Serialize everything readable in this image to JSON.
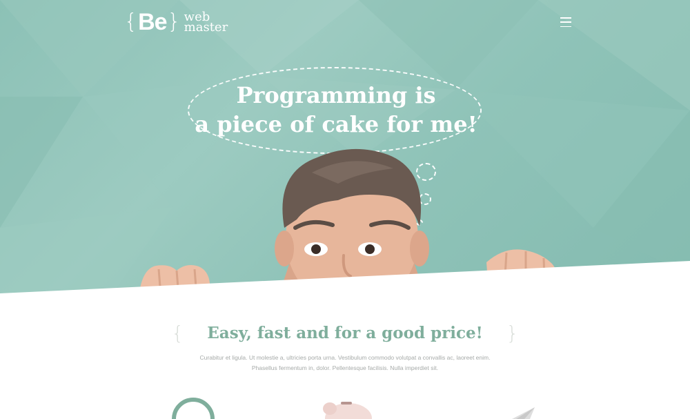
{
  "logo": {
    "brace_open": "{",
    "mark": "Be",
    "brace_close": "}",
    "word_top": "web",
    "word_bottom": "master"
  },
  "nav": {
    "menu_icon": "hamburger-menu-icon"
  },
  "hero": {
    "headline_line1": "Programming is",
    "headline_line2": "a piece of cake for me!"
  },
  "intro": {
    "brace_open": "{",
    "brace_close": "}",
    "tagline": "Easy, fast and for a good price!",
    "body_line1": "Curabitur et ligula. Ut molestie a, ultricies porta urna. Vestibulum commodo volutpat a convallis ac, laoreet enim.",
    "body_line2": "Phasellus fermentum in, dolor. Pellentesque facilisis. Nulla imperdiet sit."
  },
  "colors": {
    "hero_bg": "#8fc3b8",
    "accent": "#7fae9c",
    "body_text": "#a6aaa8",
    "brace": "#d8ddd8"
  },
  "icons": {
    "left": "circle-badge-icon",
    "center": "piggy-bank-icon",
    "right": "paper-plane-icon"
  }
}
